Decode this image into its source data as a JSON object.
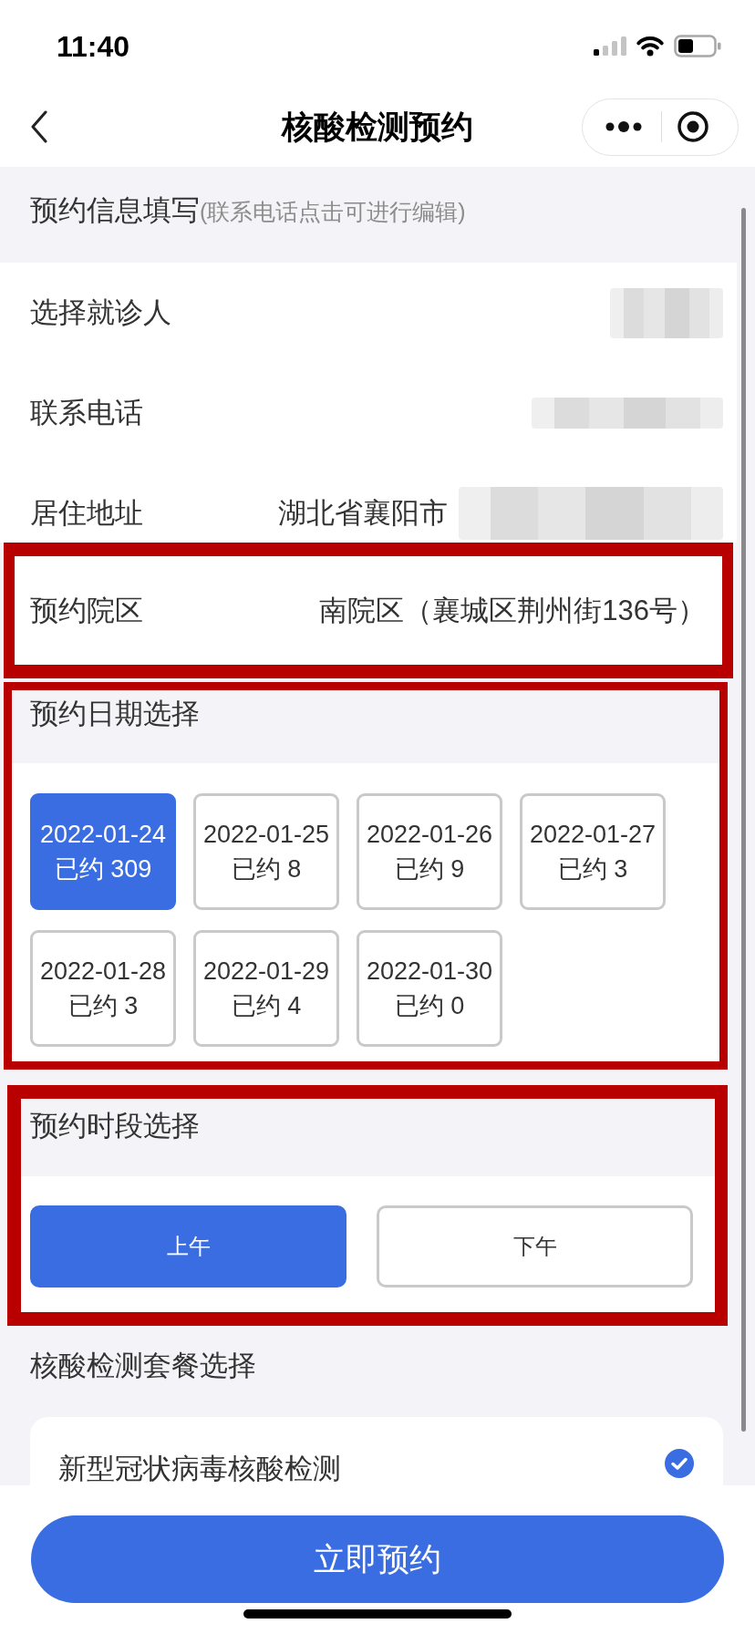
{
  "status_bar": {
    "time": "11:40"
  },
  "nav_bar": {
    "title": "核酸检测预约"
  },
  "info_section": {
    "title": "预约信息填写",
    "hint": "(联系电话点击可进行编辑)",
    "rows": [
      {
        "label": "选择就诊人",
        "redacted": true,
        "highlighted": false
      },
      {
        "label": "联系电话",
        "redacted": true,
        "highlighted": false
      },
      {
        "label": "居住地址",
        "value": "湖北省襄阳市",
        "redacted": true,
        "highlighted": false
      },
      {
        "label": "预约院区",
        "value": "南院区（襄城区荆州街136号）",
        "redacted": false,
        "highlighted": true
      }
    ]
  },
  "date_section": {
    "title": "预约日期选择",
    "highlighted": true,
    "dates": [
      {
        "date": "2022-01-24",
        "booked": "已约 309",
        "selected": true
      },
      {
        "date": "2022-01-25",
        "booked": "已约 8",
        "selected": false
      },
      {
        "date": "2022-01-26",
        "booked": "已约 9",
        "selected": false
      },
      {
        "date": "2022-01-27",
        "booked": "已约 3",
        "selected": false
      },
      {
        "date": "2022-01-28",
        "booked": "已约 3",
        "selected": false
      },
      {
        "date": "2022-01-29",
        "booked": "已约 4",
        "selected": false
      },
      {
        "date": "2022-01-30",
        "booked": "已约 0",
        "selected": false
      }
    ]
  },
  "time_section": {
    "title": "预约时段选择",
    "highlighted": true,
    "slots": [
      {
        "label": "上午",
        "selected": true
      },
      {
        "label": "下午",
        "selected": false
      }
    ]
  },
  "package_section": {
    "title": "核酸检测套餐选择",
    "items": [
      {
        "name": "新型冠状病毒核酸检测",
        "checked": true
      }
    ]
  },
  "submit_button": {
    "label": "立即预约"
  }
}
